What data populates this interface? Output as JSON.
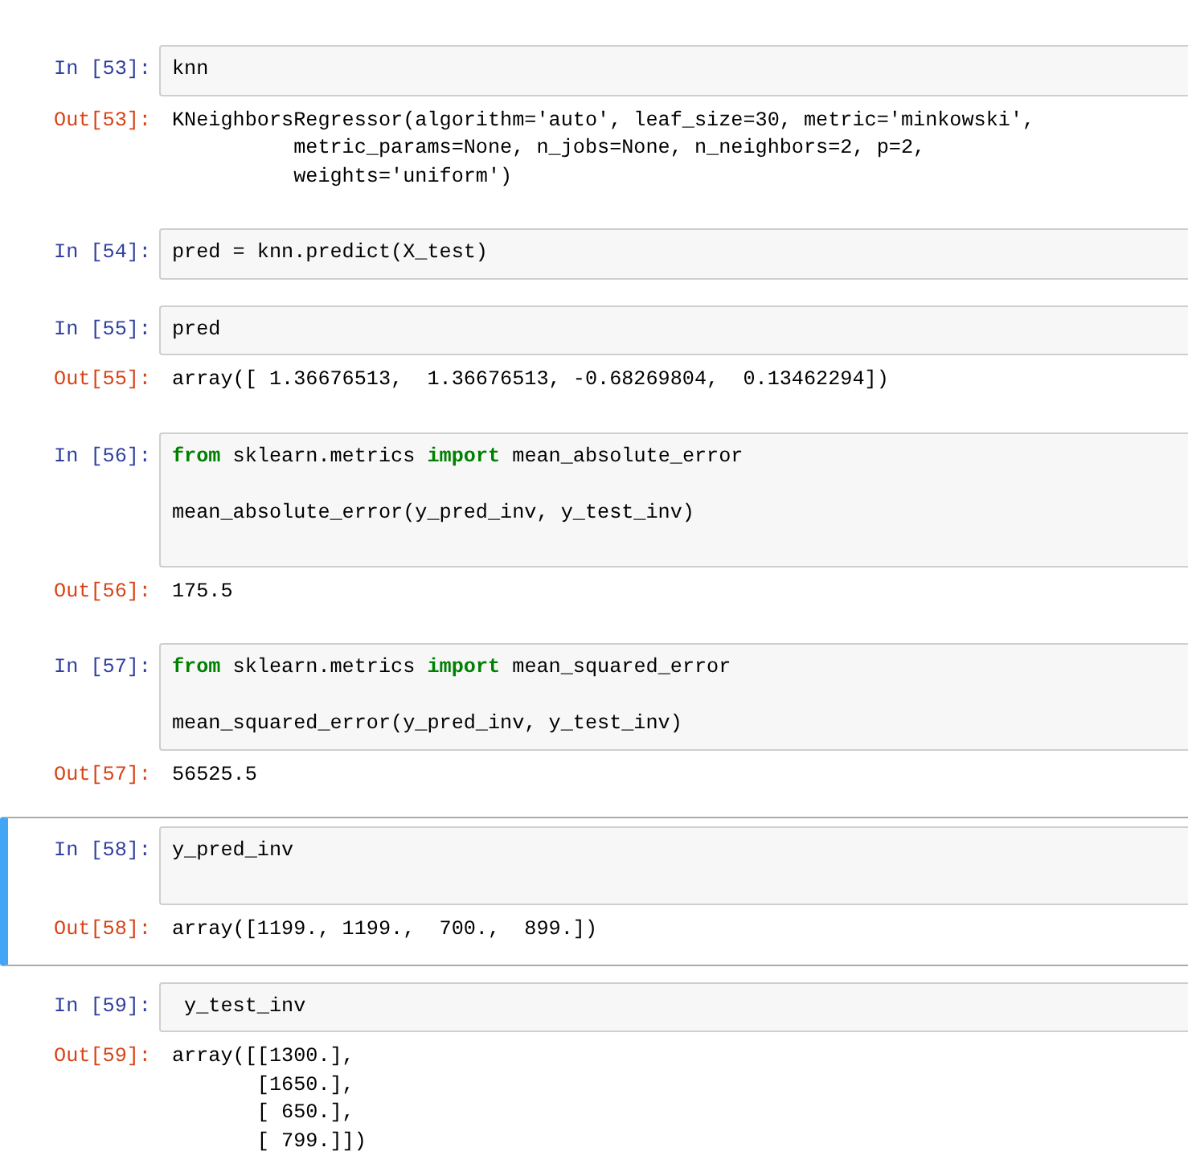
{
  "cells": [
    {
      "prompt": "In [53]:",
      "code": [
        "knn"
      ],
      "blank_line_after": false,
      "selected": false,
      "output": {
        "prompt": "Out[53]:",
        "lines": [
          "KNeighborsRegressor(algorithm='auto', leaf_size=30, metric='minkowski',",
          "          metric_params=None, n_jobs=None, n_neighbors=2, p=2,",
          "          weights='uniform')"
        ]
      }
    },
    {
      "prompt": "In [54]:",
      "code": [
        "pred = knn.predict(X_test)"
      ],
      "blank_line_after": false,
      "selected": false
    },
    {
      "prompt": "In [55]:",
      "code": [
        "pred"
      ],
      "blank_line_after": false,
      "selected": false,
      "output": {
        "prompt": "Out[55]:",
        "lines": [
          "array([ 1.36676513,  1.36676513, -0.68269804,  0.13462294])"
        ]
      }
    },
    {
      "prompt": "In [56]:",
      "code": [
        "**from** sklearn.metrics **import** mean_absolute_error",
        "mean_absolute_error(y_pred_inv, y_test_inv)"
      ],
      "blank_line_after": true,
      "selected": false,
      "output": {
        "prompt": "Out[56]:",
        "lines": [
          "175.5"
        ]
      }
    },
    {
      "prompt": "In [57]:",
      "code": [
        "**from** sklearn.metrics **import** mean_squared_error",
        "mean_squared_error(y_pred_inv, y_test_inv)"
      ],
      "blank_line_after": false,
      "selected": false,
      "output": {
        "prompt": "Out[57]:",
        "lines": [
          "56525.5"
        ]
      }
    },
    {
      "prompt": "In [58]:",
      "code": [
        "y_pred_inv"
      ],
      "blank_line_after": true,
      "selected": true,
      "output": {
        "prompt": "Out[58]:",
        "lines": [
          "array([1199., 1199.,  700.,  899.])"
        ]
      }
    },
    {
      "prompt": "In [59]:",
      "code": [
        " y_test_inv"
      ],
      "blank_line_after": false,
      "selected": false,
      "output": {
        "prompt": "Out[59]:",
        "lines": [
          "array([[1300.],",
          "       [1650.],",
          "       [ 650.],",
          "       [ 799.]])"
        ]
      }
    }
  ]
}
